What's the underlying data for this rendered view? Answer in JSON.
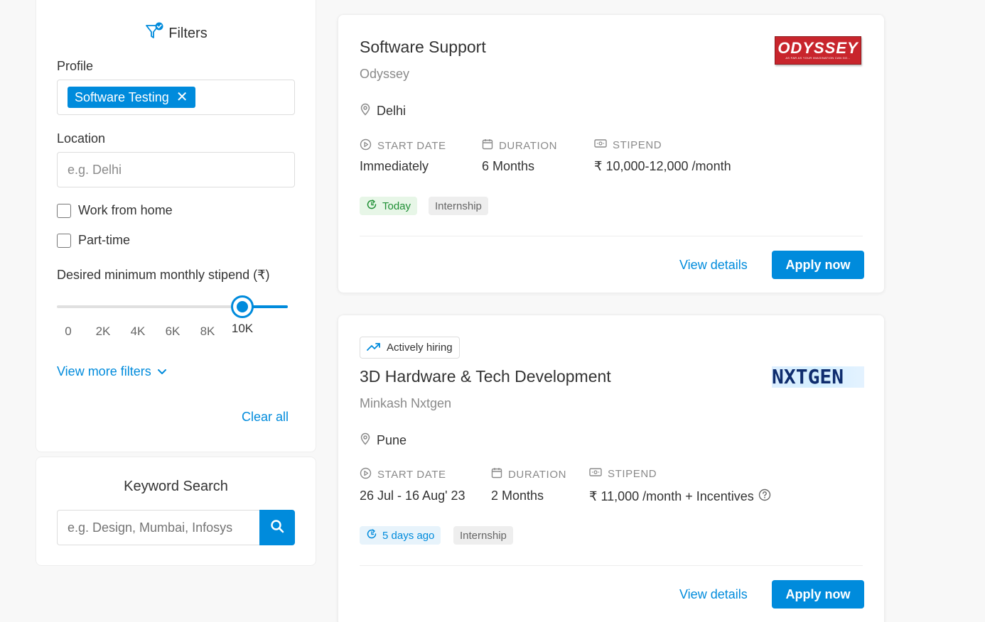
{
  "filters": {
    "title": "Filters",
    "profile_label": "Profile",
    "profile_chip": "Software Testing",
    "location_label": "Location",
    "location_placeholder": "e.g. Delhi",
    "work_from_home": "Work from home",
    "part_time": "Part-time",
    "stipend_label": "Desired minimum monthly stipend (₹)",
    "stipend_ticks": [
      "0",
      "2K",
      "4K",
      "6K",
      "8K",
      "10K"
    ],
    "stipend_selected": "10K",
    "view_more": "View more filters",
    "clear_all": "Clear all"
  },
  "keyword": {
    "title": "Keyword Search",
    "placeholder": "e.g. Design, Mumbai, Infosys"
  },
  "labels": {
    "start_date": "START DATE",
    "duration": "DURATION",
    "stipend": "STIPEND",
    "view_details": "View details",
    "apply_now": "Apply now"
  },
  "cards": [
    {
      "title": "Software Support",
      "company": "Odyssey",
      "logo_text": "ODYSSEY",
      "logo_tagline": "AS FAR AS YOUR IMAGINATION CAN GO...",
      "location": "Delhi",
      "start_date": "Immediately",
      "duration": "6 Months",
      "stipend": "₹ 10,000-12,000 /month",
      "posted": "Today",
      "type": "Internship"
    },
    {
      "hiring_badge": "Actively hiring",
      "title": "3D Hardware & Tech Development",
      "company": "Minkash Nxtgen",
      "logo_text": "NXTGEN",
      "location": "Pune",
      "start_date": "26 Jul - 16 Aug' 23",
      "duration": "2 Months",
      "stipend": "₹ 11,000 /month + Incentives",
      "posted": "5 days ago",
      "type": "Internship"
    }
  ],
  "colors": {
    "accent": "#008bdc",
    "today_badge": "#1f8f35",
    "logo_red": "#c8252c"
  }
}
